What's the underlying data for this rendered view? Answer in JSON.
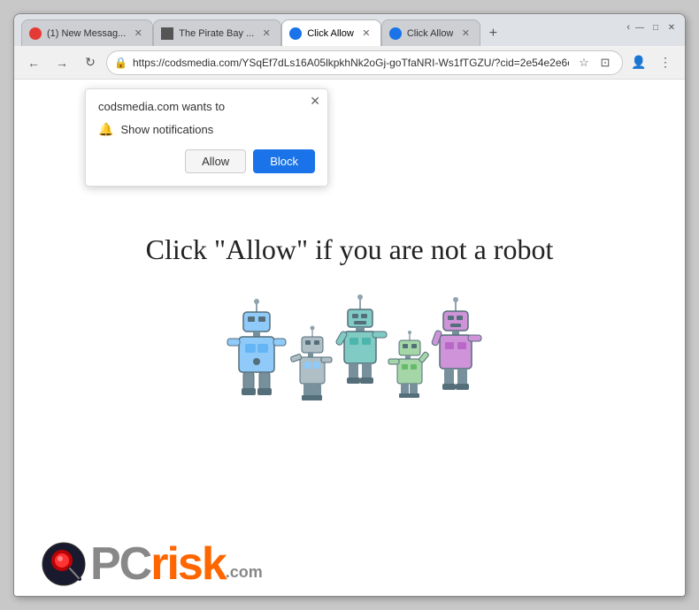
{
  "window": {
    "controls": {
      "minimize": "—",
      "maximize": "□",
      "close": "✕"
    }
  },
  "tabs": [
    {
      "id": "tab1",
      "label": "(1) New Messag...",
      "favicon_color": "#e53935",
      "active": false
    },
    {
      "id": "tab2",
      "label": "The Pirate Bay ...",
      "favicon_color": "#555",
      "active": false
    },
    {
      "id": "tab3",
      "label": "Click Allow",
      "favicon_color": "#1a73e8",
      "active": true
    },
    {
      "id": "tab4",
      "label": "Click Allow",
      "favicon_color": "#1a73e8",
      "active": false
    }
  ],
  "new_tab_label": "+",
  "nav": {
    "back_icon": "←",
    "forward_icon": "→",
    "refresh_icon": "↻",
    "address": "https://codsmedia.com/YSqEf7dLs16A05lkpkhNk2oGj-goTfaNRI-Ws1fTGZU/?cid=2e54e2e6e...",
    "lock_icon": "🔒",
    "bookmark_icon": "☆",
    "extensions_icon": "⊡",
    "profile_icon": "👤",
    "menu_icon": "⋮"
  },
  "popup": {
    "title": "codsmedia.com wants to",
    "close_icon": "✕",
    "notification_icon": "🔔",
    "notification_text": "Show notifications",
    "allow_label": "Allow",
    "block_label": "Block"
  },
  "page": {
    "headline": "Click \"Allow\"   if you are not   a robot"
  },
  "watermark": {
    "pc_text": "PC",
    "risk_text": "risk",
    "com_text": ".com"
  }
}
